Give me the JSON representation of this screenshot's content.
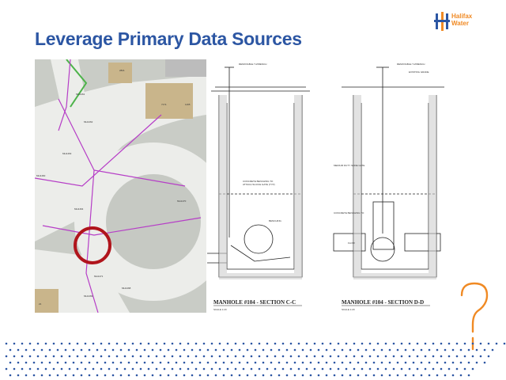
{
  "slide": {
    "title": "Leverage Primary Data Sources"
  },
  "logo": {
    "line1": "Halifax",
    "line2": "Water",
    "brand_color": "#f08a24"
  },
  "map": {
    "labels": [
      "2821",
      "7171",
      "1165",
      "MH1461",
      "MH1462",
      "MH1463",
      "MH1460",
      "MH1464",
      "MH1470",
      "MH1471",
      "MH1468",
      "MH1469",
      "21"
    ],
    "highlight_color": "#b0151c",
    "pipe_color": "#b63ec7"
  },
  "drawing": {
    "section_left": "MANHOLE #104 - SECTION C-C",
    "section_right": "MANHOLE #104 - SECTION D-D",
    "scale_left": "SCALE 1:20",
    "scale_right": "SCALE 1:20",
    "note_left_1": "CONCRETE BENCHING TO",
    "note_left_2": "ATTACH SLUICE GATE (TYP)",
    "note_benching": "BENCHING",
    "note_right_1": "MEDIUM DUTY SLIDE GATE",
    "note_right_2": "CONCRETE BENCHING TO",
    "flow_label": "FLOW",
    "existing_grade": "EXISTING GRADE",
    "removable_wrench": "REMOVABLE T-WRENCH"
  },
  "colors": {
    "title": "#2c56a3",
    "dots": "#2c56a3",
    "question_mark": "#f08a24"
  },
  "decor": {
    "question_mark_icon": "question-mark-icon",
    "dot_pattern": "dot-grid-decoration"
  }
}
